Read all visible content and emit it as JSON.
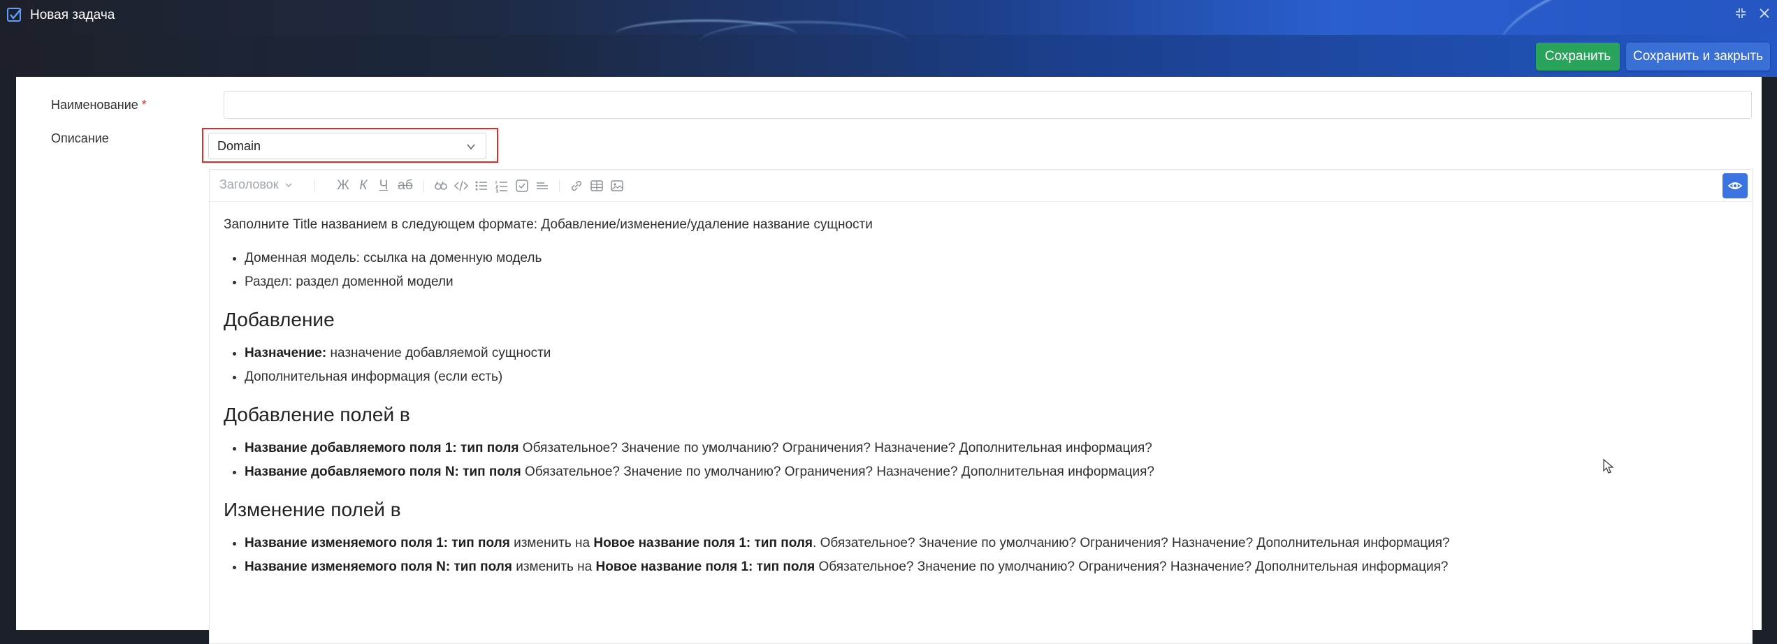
{
  "window": {
    "title": "Новая задача"
  },
  "actions": {
    "save": "Сохранить",
    "save_close": "Сохранить и закрыть"
  },
  "form": {
    "name_label": "Наименование",
    "required_mark": "*",
    "name_value": "",
    "description_label": "Описание",
    "template_select": {
      "value": "Domain"
    }
  },
  "toolbar": {
    "heading": "Заголовок",
    "bold": "Ж",
    "italic": "К",
    "underline": "Ч",
    "strike": "аб"
  },
  "content": {
    "intro": "Заполните Title названием в следующем формате: Добавление/изменение/удаление название сущности",
    "intro_items": [
      "Доменная модель: ссылка на доменную модель",
      "Раздел: раздел доменной модели"
    ],
    "section1": {
      "heading": "Добавление",
      "item1_bold": "Назначение:",
      "item1_text": " назначение добавляемой сущности",
      "item2": "Дополнительная информация (если есть)"
    },
    "section2": {
      "heading": "Добавление полей в",
      "items": [
        {
          "bold": "Название добавляемого поля 1: тип поля",
          "text": " Обязательное? Значение по умолчанию? Ограничения? Назначение? Дополнительная информация?"
        },
        {
          "bold": "Название добавляемого поля N: тип поля",
          "text": " Обязательное? Значение по умолчанию? Ограничения? Назначение? Дополнительная информация?"
        }
      ]
    },
    "section3": {
      "heading": "Изменение полей в",
      "items": [
        {
          "bold1": "Название изменяемого поля 1: тип поля",
          "mid": " изменить на ",
          "bold2": "Новое название поля 1: тип поля",
          "text": ". Обязательное? Значение по умолчанию? Ограничения? Назначение? Дополнительная информация?"
        },
        {
          "bold1": "Название изменяемого поля N: тип поля",
          "mid": " изменить на ",
          "bold2": "Новое название поля 1: тип поля",
          "text": " Обязательное? Значение по умолчанию? Ограничения? Назначение? Дополнительная информация?"
        }
      ]
    }
  },
  "colors": {
    "save": "#2aa35c",
    "save_close": "#3a6fd6",
    "highlight": "#e02b2b",
    "preview": "#3b73e0"
  }
}
